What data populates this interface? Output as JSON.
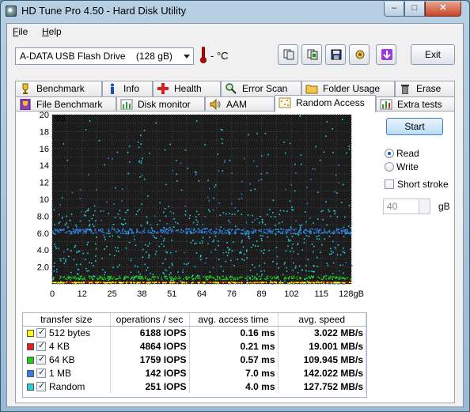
{
  "window": {
    "title": "HD Tune Pro 4.50 - Hard Disk Utility",
    "close_label": "✕",
    "min_label": "–",
    "max_label": "□"
  },
  "menu": {
    "file": "File",
    "help": "Help"
  },
  "toolbar": {
    "drive": "A-DATA USB Flash Drive    (128 gB)",
    "temperature": "- °C",
    "buttons": [
      {
        "icon": "copy-info-icon"
      },
      {
        "icon": "copy-screenshot-icon"
      },
      {
        "icon": "save-icon"
      },
      {
        "icon": "options-icon"
      },
      {
        "icon": "down-arrow-icon"
      }
    ],
    "exit_label": "Exit"
  },
  "tabs_row1": [
    "Benchmark",
    "Info",
    "Health",
    "Error Scan",
    "Folder Usage",
    "Erase"
  ],
  "tabs_row2": [
    "File Benchmark",
    "Disk monitor",
    "AAM",
    "Random Access",
    "Extra tests"
  ],
  "active_tab": "Random Access",
  "controls": {
    "start_label": "Start",
    "read_label": "Read",
    "write_label": "Write",
    "mode": "Read",
    "short_stroke_label": "Short stroke",
    "short_stroke_checked": false,
    "short_stroke_value": "40",
    "short_stroke_unit": "gB"
  },
  "chart_data": {
    "type": "scatter",
    "ylabel": "ms",
    "ylim": [
      0,
      20
    ],
    "y_ticks": [
      "20",
      "18",
      "16",
      "14",
      "12",
      "10",
      "8.0",
      "6.0",
      "4.0",
      "2.0"
    ],
    "xlim": [
      0,
      128
    ],
    "x_ticks": [
      "0",
      "12",
      "25",
      "38",
      "51",
      "64",
      "76",
      "89",
      "102",
      "115",
      "128gB"
    ],
    "grid": true,
    "background": "#1c1c1c",
    "series": [
      {
        "name": "512 bytes",
        "color": "#ffff00",
        "band_ms": 0.16,
        "spread_ms": 0.1
      },
      {
        "name": "4 KB",
        "color": "#e02020",
        "band_ms": 0.21,
        "spread_ms": 0.1
      },
      {
        "name": "64 KB",
        "color": "#22cc22",
        "band_ms": 0.57,
        "spread_ms": 0.4
      },
      {
        "name": "1 MB",
        "color": "#2f7fe0",
        "band_ms": 7.0,
        "spread_ms": 0.3
      },
      {
        "name": "Random",
        "color": "#25d0d8",
        "band_ms": 4.0,
        "spread_ms": 8.0
      }
    ]
  },
  "results": {
    "headers": [
      "transfer size",
      "operations / sec",
      "avg. access time",
      "avg. speed"
    ],
    "rows": [
      {
        "label": "512 bytes",
        "color": "#ffff00",
        "ops": "6188 IOPS",
        "access": "0.16 ms",
        "speed": "3.022 MB/s"
      },
      {
        "label": "4 KB",
        "color": "#e02020",
        "ops": "4864 IOPS",
        "access": "0.21 ms",
        "speed": "19.001 MB/s"
      },
      {
        "label": "64 KB",
        "color": "#22cc22",
        "ops": "1759 IOPS",
        "access": "0.57 ms",
        "speed": "109.945 MB/s"
      },
      {
        "label": "1 MB",
        "color": "#2f7fe0",
        "ops": "142 IOPS",
        "access": "7.0 ms",
        "speed": "142.022 MB/s"
      },
      {
        "label": "Random",
        "color": "#25d0d8",
        "ops": "251 IOPS",
        "access": "4.0 ms",
        "speed": "127.752 MB/s"
      }
    ]
  }
}
